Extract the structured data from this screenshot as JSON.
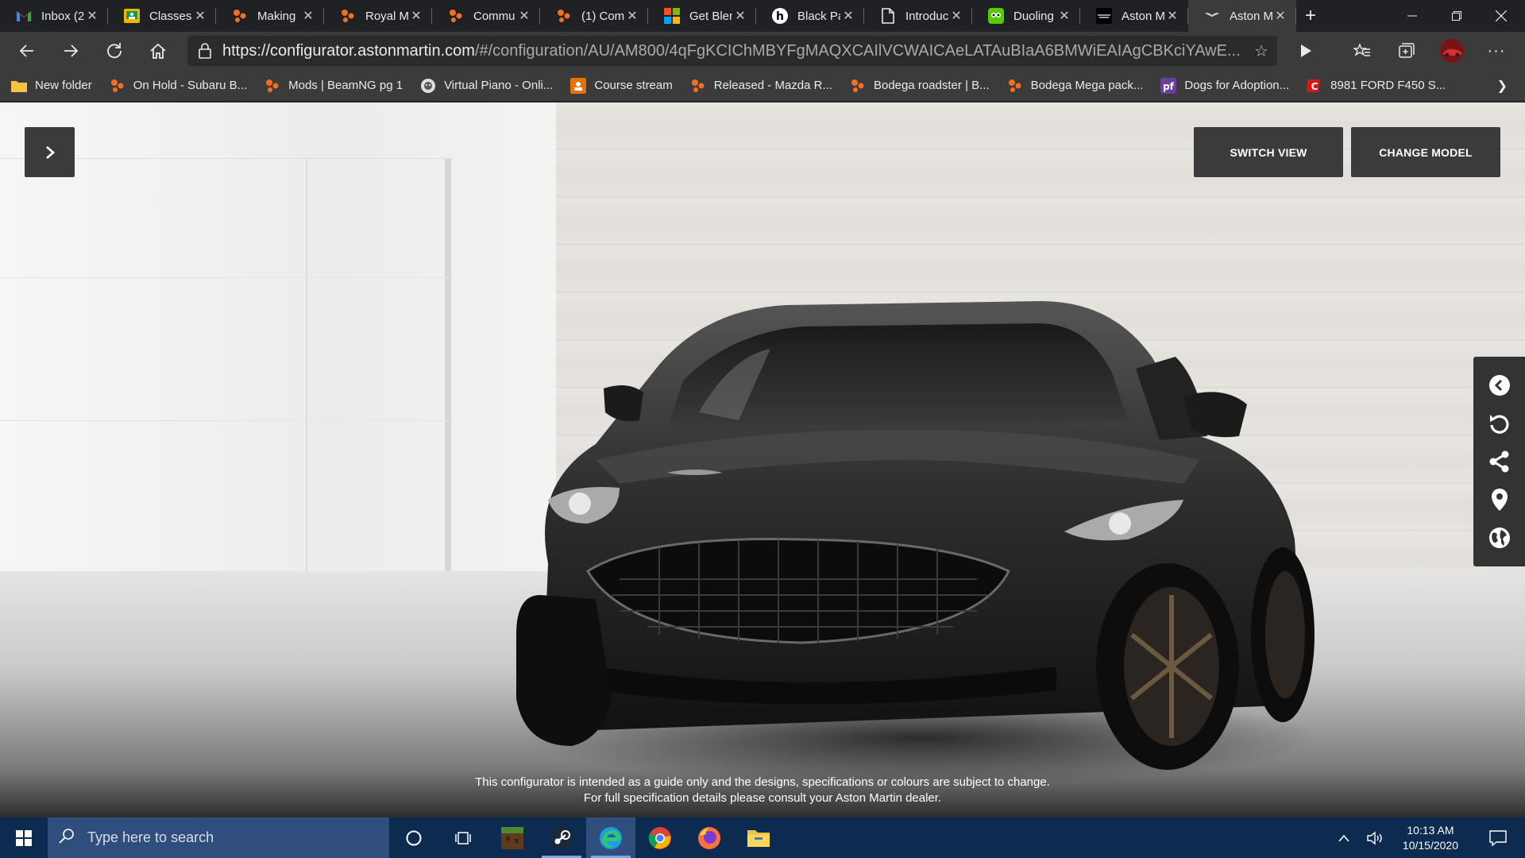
{
  "browser": {
    "tabs": [
      {
        "label": "Inbox (2",
        "icon": "gmail-icon",
        "active": false
      },
      {
        "label": "Classes",
        "icon": "google-classroom-icon",
        "active": false
      },
      {
        "label": "Making",
        "icon": "beamng-icon",
        "active": false
      },
      {
        "label": "Royal M",
        "icon": "beamng-icon",
        "active": false
      },
      {
        "label": "Commu",
        "icon": "beamng-icon",
        "active": false
      },
      {
        "label": "(1) Com",
        "icon": "beamng-icon",
        "active": false
      },
      {
        "label": "Get Blen",
        "icon": "microsoft-store-icon",
        "active": false
      },
      {
        "label": "Black Pa",
        "icon": "h-letter-icon",
        "active": false
      },
      {
        "label": "Introduc",
        "icon": "document-icon",
        "active": false
      },
      {
        "label": "Duoling",
        "icon": "duolingo-icon",
        "active": false
      },
      {
        "label": "Aston M",
        "icon": "aston-martin-icon",
        "active": false
      },
      {
        "label": "Aston M",
        "icon": "aston-martin-wings-icon",
        "active": true
      }
    ],
    "url": {
      "host": "https://configurator.astonmartin.com",
      "rest": "/#/configuration/AU/AM800/4qFgKCIChMBYFgMAQXCAIlVCWAICAeLATAuBIaA6BMWiEAIAgCBKciYAwE..."
    },
    "bookmarks": [
      {
        "label": "New folder",
        "icon": "folder-icon"
      },
      {
        "label": "On Hold - Subaru B...",
        "icon": "beamng-icon"
      },
      {
        "label": "Mods | BeamNG pg 1",
        "icon": "beamng-icon"
      },
      {
        "label": "Virtual Piano - Onli...",
        "icon": "piano-icon"
      },
      {
        "label": "Course stream",
        "icon": "classroom-stream-icon"
      },
      {
        "label": "Released - Mazda R...",
        "icon": "beamng-icon"
      },
      {
        "label": "Bodega roadster | B...",
        "icon": "beamng-icon"
      },
      {
        "label": "Bodega Mega pack...",
        "icon": "beamng-icon"
      },
      {
        "label": "Dogs for Adoption...",
        "icon": "petfinder-icon"
      },
      {
        "label": "8981 FORD F450 S...",
        "icon": "c-logo-icon"
      }
    ]
  },
  "page": {
    "buttons": {
      "switch_view": "SWITCH VIEW",
      "change_model": "CHANGE MODEL"
    },
    "side_tools": [
      "back-circle-icon",
      "reset-icon",
      "share-icon",
      "location-pin-icon",
      "globe-icon"
    ],
    "disclaimer_line1": "This configurator is intended as a guide only and the designs, specifications or colours are subject to change.",
    "disclaimer_line2": "For full specification details please consult your Aston Martin dealer."
  },
  "taskbar": {
    "search_placeholder": "Type here to search",
    "time": "10:13 AM",
    "date": "10/15/2020",
    "apps": [
      "cortana-icon",
      "task-view-icon",
      "minecraft-icon",
      "steam-icon",
      "edge-icon",
      "chrome-icon",
      "firefox-icon",
      "file-explorer-icon"
    ]
  },
  "colors": {
    "tab_bg": "#202124",
    "toolbar_bg": "#3b3b3b",
    "taskbar_bg": "#0d2a50",
    "overlay_button_bg": "#3b3b3b",
    "beamng_orange": "#f36f21"
  }
}
